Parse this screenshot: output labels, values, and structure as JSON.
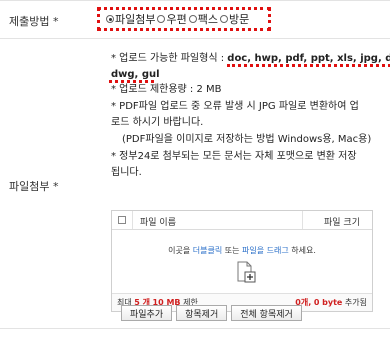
{
  "form": {
    "submit_method_label": "제출방법 *",
    "attachment_label": "파일첨부 *",
    "options": [
      "파일첨부",
      "우편",
      "팩스",
      "방문"
    ],
    "selected_option": "파일첨부"
  },
  "info": {
    "formats_prefix": "* 업로드 가능한 파일형식 :",
    "formats_list_1": "doc, hwp, pdf, ppt, xls, jpg, dwf,",
    "formats_list_2": "dwg, gul",
    "limit_text": "* 업로드 제한용량 : 2 MB",
    "pdf_notice_1": "* PDF파일 업로드 중 오류 발생 시 JPG 파일로 변환하여 업",
    "pdf_notice_2": "로드 하시기 바랍니다.",
    "pdf_save_method": "(PDF파일을 이미지로 저장하는 방법  Windows용, Mac용)",
    "gov24_notice_1": "* 정부24로 첨부되는 모든 문서는 자체 포맷으로 변환 저장",
    "gov24_notice_2": "됩니다."
  },
  "uploader": {
    "col_filename": "파일 이름",
    "col_filesize": "파일 크기",
    "drop_prefix": "이곳을",
    "drop_dblclick": "더블클릭",
    "drop_mid": "또는",
    "drop_drag": "파일을 드래그",
    "drop_suffix": "하세요.",
    "footer_max_prefix": "최대",
    "footer_max_count": "5 개",
    "footer_max_size": "10 MB",
    "footer_max_suffix": "제한",
    "footer_count": "0개,",
    "footer_bytes": "0 byte",
    "footer_added": "추가됨"
  },
  "buttons": {
    "add_file": "파일추가",
    "remove_item": "항목제거",
    "remove_all": "전체 항목제거"
  }
}
